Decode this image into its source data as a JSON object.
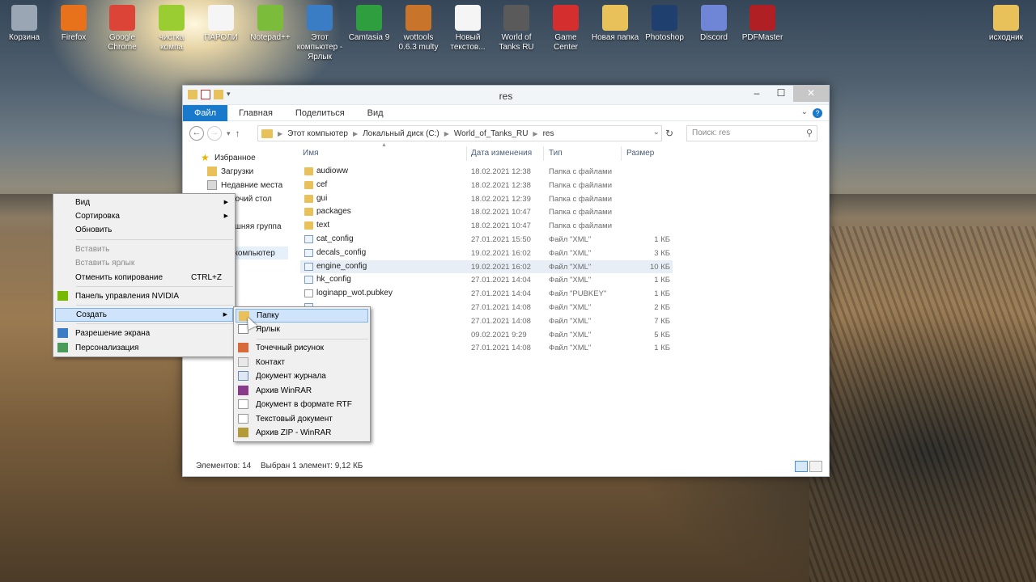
{
  "desktop": {
    "icons": [
      {
        "label": "Корзина",
        "icon": "recycle-bin-icon",
        "color": "#9aa6b3"
      },
      {
        "label": "Firefox",
        "icon": "firefox-icon",
        "color": "#e8711c"
      },
      {
        "label": "Google Chrome",
        "icon": "chrome-icon",
        "color": "#db4437"
      },
      {
        "label": "чистка компа",
        "icon": "folder-zip-icon",
        "color": "#9acd32"
      },
      {
        "label": "ПАРОЛИ",
        "icon": "text-file-icon",
        "color": "#f5f5f5"
      },
      {
        "label": "Notepad++",
        "icon": "notepad-plus-icon",
        "color": "#7bbd3a"
      },
      {
        "label": "Этот компьютер - Ярлык",
        "icon": "computer-icon",
        "color": "#3b7dc4"
      },
      {
        "label": "Camtasia 9",
        "icon": "camtasia-icon",
        "color": "#2e9e3e"
      },
      {
        "label": "wottools 0.6.3 multy",
        "icon": "wottools-icon",
        "color": "#c9742b"
      },
      {
        "label": "Новый текстов...",
        "icon": "text-file-icon",
        "color": "#f5f5f5"
      },
      {
        "label": "World of Tanks RU",
        "icon": "wot-icon",
        "color": "#5a5a5a"
      },
      {
        "label": "Game Center",
        "icon": "game-center-icon",
        "color": "#d42e2e"
      },
      {
        "label": "Новая папка",
        "icon": "folder-icon",
        "color": "#e8c15a"
      },
      {
        "label": "Photoshop",
        "icon": "photoshop-icon",
        "color": "#1f3f6e"
      },
      {
        "label": "Discord",
        "icon": "discord-icon",
        "color": "#6f86d6"
      },
      {
        "label": "PDFMaster",
        "icon": "pdfmaster-icon",
        "color": "#b01f24"
      }
    ],
    "right_icon": {
      "label": "исходник",
      "icon": "folder-icon",
      "color": "#e8c15a"
    }
  },
  "explorer": {
    "title": "res",
    "ribbon_tabs": [
      "Файл",
      "Главная",
      "Поделиться",
      "Вид"
    ],
    "help_glyph": "?",
    "address": {
      "crumbs": [
        "Этот компьютер",
        "Локальный диск (C:)",
        "World_of_Tanks_RU",
        "res"
      ]
    },
    "search_placeholder": "Поиск: res",
    "nav": {
      "favorites": "Избранное",
      "downloads": "Загрузки",
      "recent": "Недавние места",
      "desktop": "Рабочий стол",
      "homegroup": "Домашняя группа",
      "computer": "Этот компьютер"
    },
    "columns": {
      "name": "Имя",
      "date": "Дата изменения",
      "type": "Тип",
      "size": "Размер"
    },
    "files": [
      {
        "name": "audioww",
        "date": "18.02.2021 12:38",
        "type": "Папка с файлами",
        "size": "",
        "kind": "folder"
      },
      {
        "name": "cef",
        "date": "18.02.2021 12:38",
        "type": "Папка с файлами",
        "size": "",
        "kind": "folder"
      },
      {
        "name": "gui",
        "date": "18.02.2021 12:39",
        "type": "Папка с файлами",
        "size": "",
        "kind": "folder"
      },
      {
        "name": "packages",
        "date": "18.02.2021 10:47",
        "type": "Папка с файлами",
        "size": "",
        "kind": "folder"
      },
      {
        "name": "text",
        "date": "18.02.2021 10:47",
        "type": "Папка с файлами",
        "size": "",
        "kind": "folder"
      },
      {
        "name": "cat_config",
        "date": "27.01.2021 15:50",
        "type": "Файл \"XML\"",
        "size": "1 КБ",
        "kind": "xml"
      },
      {
        "name": "decals_config",
        "date": "19.02.2021 16:02",
        "type": "Файл \"XML\"",
        "size": "3 КБ",
        "kind": "xml"
      },
      {
        "name": "engine_config",
        "date": "19.02.2021 16:02",
        "type": "Файл \"XML\"",
        "size": "10 КБ",
        "kind": "xml"
      },
      {
        "name": "hk_config",
        "date": "27.01.2021 14:04",
        "type": "Файл \"XML\"",
        "size": "1 КБ",
        "kind": "xml"
      },
      {
        "name": "loginapp_wot.pubkey",
        "date": "27.01.2021 14:04",
        "type": "Файл \"PUBKEY\"",
        "size": "1 КБ",
        "kind": "doc"
      },
      {
        "name": "",
        "date": "27.01.2021 14:08",
        "type": "Файл \"XML\"",
        "size": "2 КБ",
        "kind": "xml"
      },
      {
        "name": "",
        "date": "27.01.2021 14:08",
        "type": "Файл \"XML\"",
        "size": "7 КБ",
        "kind": "xml"
      },
      {
        "name": "",
        "date": "09.02.2021 9:29",
        "type": "Файл \"XML\"",
        "size": "5 КБ",
        "kind": "xml"
      },
      {
        "name": "g",
        "date": "27.01.2021 14:08",
        "type": "Файл \"XML\"",
        "size": "1 КБ",
        "kind": "xml"
      }
    ],
    "status": {
      "count": "Элементов: 14",
      "selected": "Выбран 1 элемент: 9,12 КБ"
    }
  },
  "context_menu": {
    "items": {
      "view": "Вид",
      "sort": "Сортировка",
      "refresh": "Обновить",
      "paste": "Вставить",
      "paste_shortcut": "Вставить ярлык",
      "undo_copy": "Отменить копирование",
      "undo_shortcut": "CTRL+Z",
      "nvidia": "Панель управления NVIDIA",
      "create": "Создать",
      "resolution": "Разрешение экрана",
      "personalize": "Персонализация"
    }
  },
  "submenu": {
    "items": [
      "Папку",
      "Ярлык",
      "Точечный рисунок",
      "Контакт",
      "Документ журнала",
      "Архив WinRAR",
      "Документ в формате RTF",
      "Текстовый документ",
      "Архив ZIP - WinRAR"
    ]
  }
}
